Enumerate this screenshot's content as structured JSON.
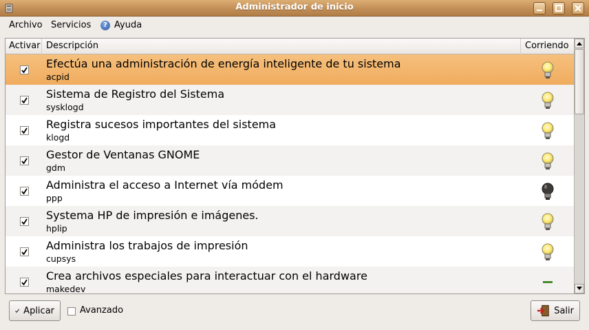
{
  "window": {
    "title": "Administrador de inicio",
    "buttons": {
      "minimize": "minimize",
      "maximize": "maximize",
      "close": "close"
    }
  },
  "menu": [
    {
      "label": "Archivo"
    },
    {
      "label": "Servicios"
    },
    {
      "label": "Ayuda",
      "icon": "help-icon"
    }
  ],
  "table": {
    "columns": [
      "Activar",
      "Descripción",
      "Corriendo"
    ],
    "rows": [
      {
        "title": "Efectúa una administración de energía inteligente de tu sistema",
        "name": "acpid",
        "active": true,
        "running": "bulb-on",
        "selected": true
      },
      {
        "title": "Sistema de Registro del Sistema",
        "name": "sysklogd",
        "active": true,
        "running": "bulb-on"
      },
      {
        "title": "Registra sucesos importantes del sistema",
        "name": "klogd",
        "active": true,
        "running": "bulb-on"
      },
      {
        "title": "Gestor de Ventanas GNOME",
        "name": "gdm",
        "active": true,
        "running": "bulb-on"
      },
      {
        "title": "Administra el acceso a Internet vía módem",
        "name": "ppp",
        "active": true,
        "running": "bulb-off"
      },
      {
        "title": "Systema HP de impresión e imágenes.",
        "name": "hplip",
        "active": true,
        "running": "bulb-on"
      },
      {
        "title": "Administra los trabajos de impresión",
        "name": "cupsys",
        "active": true,
        "running": "bulb-on"
      },
      {
        "title": "Crea archivos especiales para interactuar con el hardware",
        "name": "makedev",
        "active": true,
        "running": "dash"
      }
    ]
  },
  "footer": {
    "apply_label": "Aplicar",
    "advanced_label": "Avanzado",
    "advanced_checked": false,
    "quit_label": "Salir"
  },
  "colors": {
    "titlebar": "#c5915a",
    "selection": "#f0ac5e",
    "window_bg": "#efebe7"
  }
}
